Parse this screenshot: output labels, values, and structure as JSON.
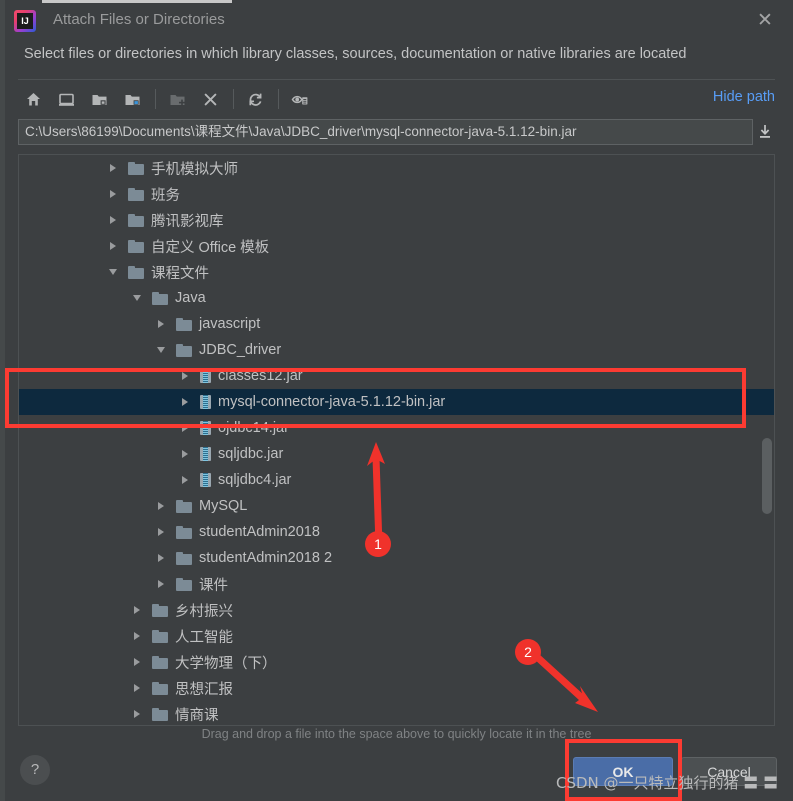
{
  "window": {
    "title": "Attach Files or Directories",
    "app_icon": "intellij-idea-icon",
    "close_label": "✕",
    "subtitle": "Select files or directories in which library classes, sources, documentation or native libraries are located"
  },
  "toolbar": {
    "hide_path_label": "Hide path",
    "buttons": [
      {
        "name": "home-icon",
        "title": "Home",
        "enabled": true
      },
      {
        "name": "desktop-icon",
        "title": "Desktop",
        "enabled": true
      },
      {
        "name": "project-folder-icon",
        "title": "Project Directory",
        "enabled": true
      },
      {
        "name": "module-folder-icon",
        "title": "Module Directory",
        "enabled": true
      },
      {
        "name": "new-folder-icon",
        "title": "New Folder",
        "enabled": false
      },
      {
        "name": "delete-icon",
        "title": "Delete",
        "enabled": true
      },
      {
        "name": "refresh-icon",
        "title": "Refresh",
        "enabled": true
      },
      {
        "name": "show-hidden-files-icon",
        "title": "Show Hidden Files and Directories",
        "enabled": true
      }
    ]
  },
  "path": {
    "value": "C:\\Users\\86199\\Documents\\课程文件\\Java\\JDBC_driver\\mysql-connector-java-5.1.12-bin.jar",
    "dropdown_icon": "download-arrow-icon"
  },
  "tree": {
    "rows": [
      {
        "label": "手机模拟大师",
        "indent": 1,
        "twisty": "collapsed",
        "icon": "folder",
        "selected": false
      },
      {
        "label": "班务",
        "indent": 1,
        "twisty": "collapsed",
        "icon": "folder",
        "selected": false
      },
      {
        "label": "腾讯影视库",
        "indent": 1,
        "twisty": "collapsed",
        "icon": "folder",
        "selected": false
      },
      {
        "label": "自定义 Office 模板",
        "indent": 1,
        "twisty": "collapsed",
        "icon": "folder",
        "selected": false
      },
      {
        "label": "课程文件",
        "indent": 1,
        "twisty": "expanded",
        "icon": "folder",
        "selected": false
      },
      {
        "label": "Java",
        "indent": 2,
        "twisty": "expanded",
        "icon": "folder",
        "selected": false
      },
      {
        "label": "javascript",
        "indent": 3,
        "twisty": "collapsed",
        "icon": "folder",
        "selected": false
      },
      {
        "label": "JDBC_driver",
        "indent": 3,
        "twisty": "expanded",
        "icon": "folder",
        "selected": false
      },
      {
        "label": "classes12.jar",
        "indent": 4,
        "twisty": "collapsed",
        "icon": "jar",
        "selected": false
      },
      {
        "label": "mysql-connector-java-5.1.12-bin.jar",
        "indent": 4,
        "twisty": "collapsed",
        "icon": "jar",
        "selected": true
      },
      {
        "label": "ojdbc14.jar",
        "indent": 4,
        "twisty": "collapsed",
        "icon": "jar",
        "selected": false
      },
      {
        "label": "sqljdbc.jar",
        "indent": 4,
        "twisty": "collapsed",
        "icon": "jar",
        "selected": false
      },
      {
        "label": "sqljdbc4.jar",
        "indent": 4,
        "twisty": "collapsed",
        "icon": "jar",
        "selected": false
      },
      {
        "label": "MySQL",
        "indent": 3,
        "twisty": "collapsed",
        "icon": "folder",
        "selected": false
      },
      {
        "label": "studentAdmin2018",
        "indent": 3,
        "twisty": "collapsed",
        "icon": "folder",
        "selected": false
      },
      {
        "label": "studentAdmin2018 2",
        "indent": 3,
        "twisty": "collapsed",
        "icon": "folder",
        "selected": false
      },
      {
        "label": "课件",
        "indent": 3,
        "twisty": "collapsed",
        "icon": "folder",
        "selected": false
      },
      {
        "label": "乡村振兴",
        "indent": 2,
        "twisty": "collapsed",
        "icon": "folder",
        "selected": false
      },
      {
        "label": "人工智能",
        "indent": 2,
        "twisty": "collapsed",
        "icon": "folder",
        "selected": false
      },
      {
        "label": "大学物理（下）",
        "indent": 2,
        "twisty": "collapsed",
        "icon": "folder",
        "selected": false
      },
      {
        "label": "思想汇报",
        "indent": 2,
        "twisty": "collapsed",
        "icon": "folder",
        "selected": false
      },
      {
        "label": "情商课",
        "indent": 2,
        "twisty": "collapsed",
        "icon": "folder",
        "selected": false
      }
    ]
  },
  "footer": {
    "hint": "Drag and drop a file into the space above to quickly locate it in the tree",
    "help_label": "?",
    "ok_label": "OK",
    "cancel_label": "Cancel"
  },
  "annotations": {
    "marker1": "1",
    "marker2": "2"
  },
  "watermark": {
    "text": "CSDN @一只特立独行的猪 〓 〓"
  },
  "colors": {
    "accent_link": "#589df6",
    "selection": "#0d293e",
    "annotation_red": "#fc3b32",
    "ok_button": "#4a6da7",
    "window_bg": "#3c3f41"
  }
}
